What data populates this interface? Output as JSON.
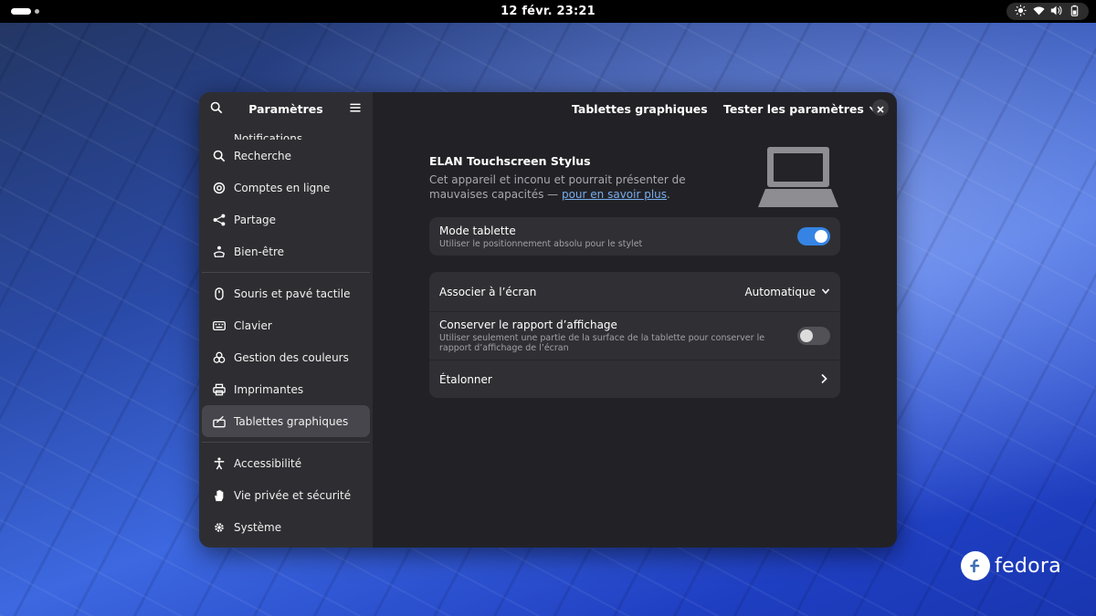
{
  "topbar": {
    "clock": "12 févr.  23:21",
    "status_icons": [
      "brightness-icon",
      "wifi-icon",
      "volume-icon",
      "battery-icon"
    ]
  },
  "sidebar": {
    "title": "Paramètres",
    "items": [
      {
        "label": "Notifications",
        "icon": "bell-icon"
      },
      {
        "label": "Recherche",
        "icon": "search-icon"
      },
      {
        "label": "Comptes en ligne",
        "icon": "at-icon"
      },
      {
        "label": "Partage",
        "icon": "share-icon"
      },
      {
        "label": "Bien-être",
        "icon": "wellbeing-icon"
      },
      {
        "label": "Souris et pavé tactile",
        "icon": "mouse-icon"
      },
      {
        "label": "Clavier",
        "icon": "keyboard-icon"
      },
      {
        "label": "Gestion des couleurs",
        "icon": "color-icon"
      },
      {
        "label": "Imprimantes",
        "icon": "printer-icon"
      },
      {
        "label": "Tablettes graphiques",
        "icon": "tablet-icon"
      },
      {
        "label": "Accessibilité",
        "icon": "accessibility-icon"
      },
      {
        "label": "Vie privée et sécurité",
        "icon": "privacy-hand-icon"
      },
      {
        "label": "Système",
        "icon": "gear-icon"
      }
    ],
    "selected": "Tablettes graphiques"
  },
  "main": {
    "title": "Tablettes graphiques",
    "test_button": "Tester les paramètres",
    "device": {
      "name": "ELAN Touchscreen Stylus",
      "desc_before": "Cet appareil et inconu et pourrait présenter de mauvaises capacités — ",
      "desc_link": "pour en savoir plus",
      "desc_after": "."
    },
    "tablet_mode": {
      "label": "Mode tablette",
      "subtitle": "Utiliser le positionnement absolu pour le stylet",
      "enabled": true
    },
    "map_screen": {
      "label": "Associer à l’écran",
      "value": "Automatique"
    },
    "keep_ratio": {
      "label": "Conserver le rapport d’affichage",
      "subtitle": "Utiliser seulement une partie de la surface de la tablette pour conserver le rapport d’affichage de l’écran",
      "enabled": false
    },
    "calibrate": {
      "label": "Étalonner"
    }
  },
  "branding": {
    "word": "fedora"
  },
  "colors": {
    "accent": "#3584e4",
    "link": "#78aeed",
    "window_bg": "#222226",
    "sidebar_bg": "#2e2e32"
  }
}
